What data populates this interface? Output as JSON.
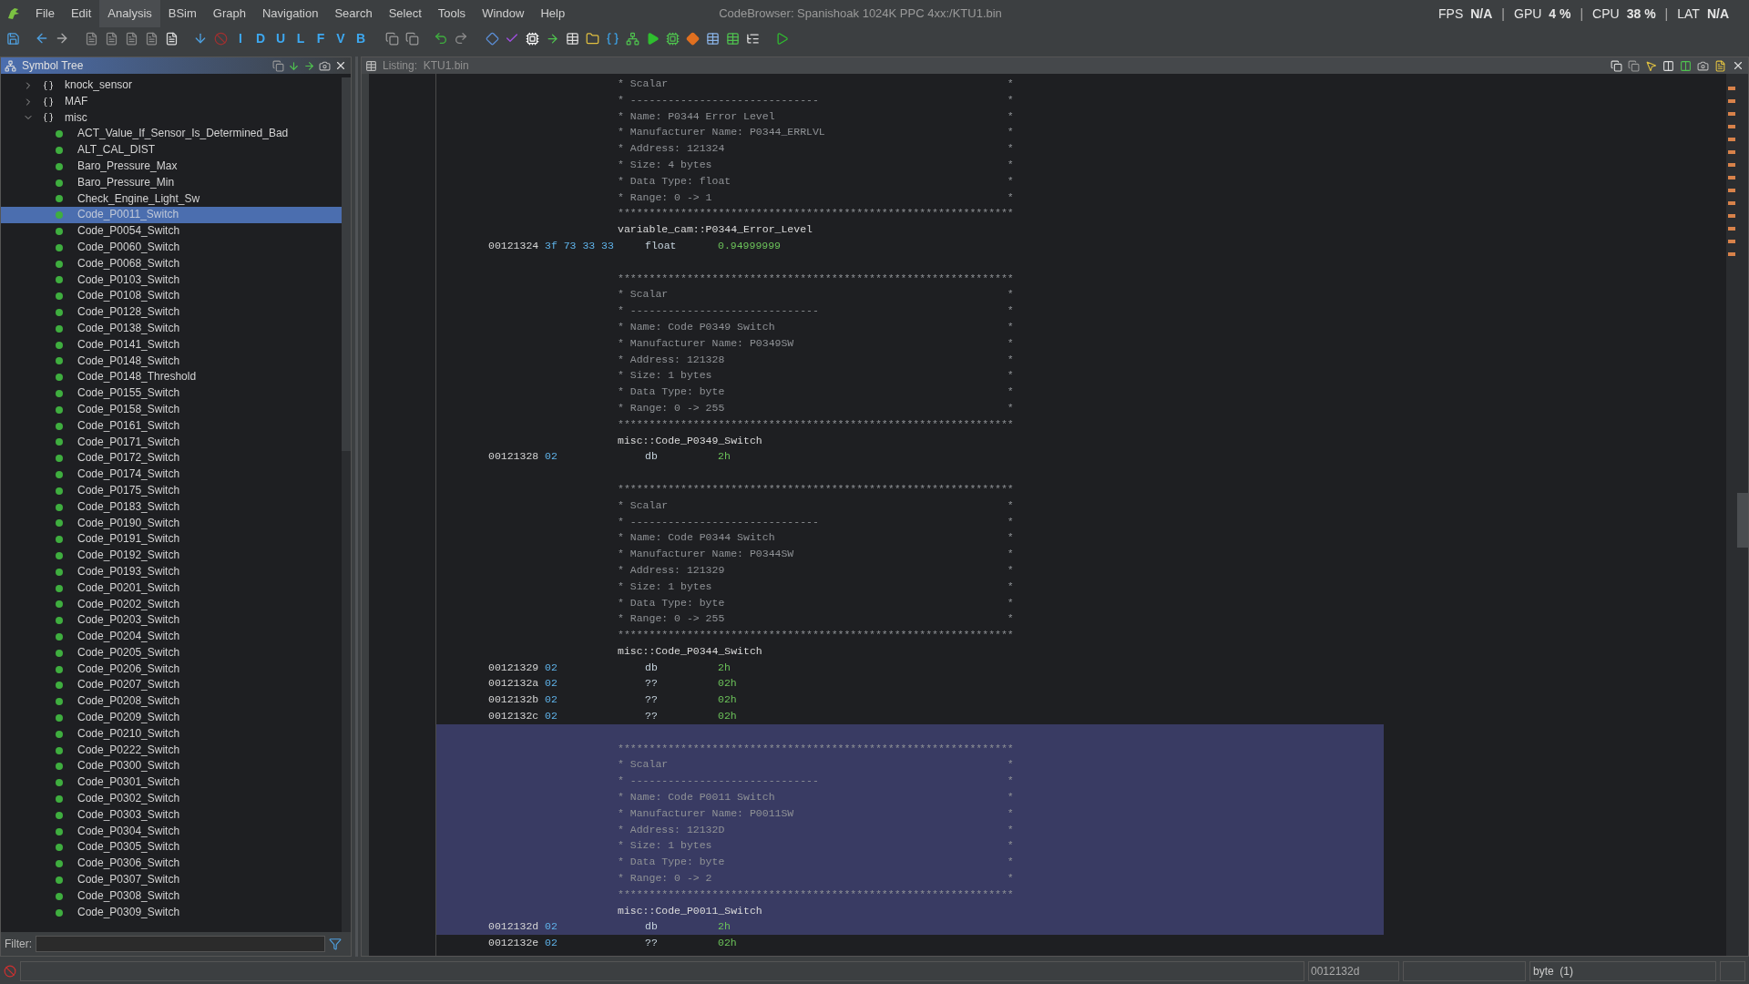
{
  "window": {
    "title": "CodeBrowser: Spanishoak 1024K PPC 4xx:/KTU1.bin"
  },
  "menu": [
    {
      "label": "File",
      "selected": false
    },
    {
      "label": "Edit",
      "selected": false
    },
    {
      "label": "Analysis",
      "selected": true
    },
    {
      "label": "BSim",
      "selected": false
    },
    {
      "label": "Graph",
      "selected": false
    },
    {
      "label": "Navigation",
      "selected": false
    },
    {
      "label": "Search",
      "selected": false
    },
    {
      "label": "Select",
      "selected": false
    },
    {
      "label": "Tools",
      "selected": false
    },
    {
      "label": "Window",
      "selected": false
    },
    {
      "label": "Help",
      "selected": false
    }
  ],
  "stats": [
    {
      "kind": "stat",
      "label": "FPS",
      "value": "N/A"
    },
    {
      "kind": "separator",
      "text": "|"
    },
    {
      "kind": "stat",
      "label": "GPU",
      "value": "4 %"
    },
    {
      "kind": "separator",
      "text": "|"
    },
    {
      "kind": "stat",
      "label": "CPU",
      "value": "38 %"
    },
    {
      "kind": "separator",
      "text": "|"
    },
    {
      "kind": "stat",
      "label": "LAT",
      "value": "N/A"
    }
  ],
  "toolbar": {
    "letter_buttons": [
      "I",
      "D",
      "U",
      "L",
      "F",
      "V",
      "B"
    ]
  },
  "symbol_tree": {
    "title": "Symbol Tree",
    "items": [
      {
        "label": "knock_sensor",
        "expanded": false
      },
      {
        "label": "MAF",
        "expanded": false
      },
      {
        "label": "misc",
        "expanded": true,
        "children": [
          {
            "label": "ACT_Value_If_Sensor_Is_Determined_Bad",
            "selected": false
          },
          {
            "label": "ALT_CAL_DIST",
            "selected": false
          },
          {
            "label": "Baro_Pressure_Max",
            "selected": false
          },
          {
            "label": "Baro_Pressure_Min",
            "selected": false
          },
          {
            "label": "Check_Engine_Light_Sw",
            "selected": false
          },
          {
            "label": "Code_P0011_Switch",
            "selected": true
          },
          {
            "label": "Code_P0054_Switch",
            "selected": false
          },
          {
            "label": "Code_P0060_Switch",
            "selected": false
          },
          {
            "label": "Code_P0068_Switch",
            "selected": false
          },
          {
            "label": "Code_P0103_Switch",
            "selected": false
          },
          {
            "label": "Code_P0108_Switch",
            "selected": false
          },
          {
            "label": "Code_P0128_Switch",
            "selected": false
          },
          {
            "label": "Code_P0138_Switch",
            "selected": false
          },
          {
            "label": "Code_P0141_Switch",
            "selected": false
          },
          {
            "label": "Code_P0148_Switch",
            "selected": false
          },
          {
            "label": "Code_P0148_Threshold",
            "selected": false
          },
          {
            "label": "Code_P0155_Switch",
            "selected": false
          },
          {
            "label": "Code_P0158_Switch",
            "selected": false
          },
          {
            "label": "Code_P0161_Switch",
            "selected": false
          },
          {
            "label": "Code_P0171_Switch",
            "selected": false
          },
          {
            "label": "Code_P0172_Switch",
            "selected": false
          },
          {
            "label": "Code_P0174_Switch",
            "selected": false
          },
          {
            "label": "Code_P0175_Switch",
            "selected": false
          },
          {
            "label": "Code_P0183_Switch",
            "selected": false
          },
          {
            "label": "Code_P0190_Switch",
            "selected": false
          },
          {
            "label": "Code_P0191_Switch",
            "selected": false
          },
          {
            "label": "Code_P0192_Switch",
            "selected": false
          },
          {
            "label": "Code_P0193_Switch",
            "selected": false
          },
          {
            "label": "Code_P0201_Switch",
            "selected": false
          },
          {
            "label": "Code_P0202_Switch",
            "selected": false
          },
          {
            "label": "Code_P0203_Switch",
            "selected": false
          },
          {
            "label": "Code_P0204_Switch",
            "selected": false
          },
          {
            "label": "Code_P0205_Switch",
            "selected": false
          },
          {
            "label": "Code_P0206_Switch",
            "selected": false
          },
          {
            "label": "Code_P0207_Switch",
            "selected": false
          },
          {
            "label": "Code_P0208_Switch",
            "selected": false
          },
          {
            "label": "Code_P0209_Switch",
            "selected": false
          },
          {
            "label": "Code_P0210_Switch",
            "selected": false
          },
          {
            "label": "Code_P0222_Switch",
            "selected": false
          },
          {
            "label": "Code_P0300_Switch",
            "selected": false
          },
          {
            "label": "Code_P0301_Switch",
            "selected": false
          },
          {
            "label": "Code_P0302_Switch",
            "selected": false
          },
          {
            "label": "Code_P0303_Switch",
            "selected": false
          },
          {
            "label": "Code_P0304_Switch",
            "selected": false
          },
          {
            "label": "Code_P0305_Switch",
            "selected": false
          },
          {
            "label": "Code_P0306_Switch",
            "selected": false
          },
          {
            "label": "Code_P0307_Switch",
            "selected": false
          },
          {
            "label": "Code_P0308_Switch",
            "selected": false
          },
          {
            "label": "Code_P0309_Switch",
            "selected": false
          }
        ]
      }
    ],
    "filter_label": "Filter:"
  },
  "listing": {
    "title": "Listing:  KTU1.bin",
    "blocks": [
      {
        "selected": false,
        "comment": [
          "* Scalar                                                      *",
          "* ------------------------------                              *",
          "* Name: P0344 Error Level                                     *",
          "* Manufacturer Name: P0344_ERRLVL                             *",
          "* Address: 121324                                             *",
          "* Size: 4 bytes                                               *",
          "* Data Type: float                                            *",
          "* Range: 0 -> 1                                               *",
          "***************************************************************"
        ],
        "label": "variable_cam::P0344_Error_Level",
        "rows": [
          {
            "address": "00121324",
            "bytes": "3f 73 33 33",
            "mnemonic": "float",
            "operand": "0.94999999"
          }
        ]
      },
      {
        "selected": false,
        "comment": [
          "***************************************************************",
          "* Scalar                                                      *",
          "* ------------------------------                              *",
          "* Name: Code P0349 Switch                                     *",
          "* Manufacturer Name: P0349SW                                  *",
          "* Address: 121328                                             *",
          "* Size: 1 bytes                                               *",
          "* Data Type: byte                                             *",
          "* Range: 0 -> 255                                             *",
          "***************************************************************"
        ],
        "label": "misc::Code_P0349_Switch",
        "rows": [
          {
            "address": "00121328",
            "bytes": "02",
            "mnemonic": "db",
            "operand": "2h"
          }
        ]
      },
      {
        "selected": false,
        "comment": [
          "***************************************************************",
          "* Scalar                                                      *",
          "* ------------------------------                              *",
          "* Name: Code P0344 Switch                                     *",
          "* Manufacturer Name: P0344SW                                  *",
          "* Address: 121329                                             *",
          "* Size: 1 bytes                                               *",
          "* Data Type: byte                                             *",
          "* Range: 0 -> 255                                             *",
          "***************************************************************"
        ],
        "label": "misc::Code_P0344_Switch",
        "rows": [
          {
            "address": "00121329",
            "bytes": "02",
            "mnemonic": "db",
            "operand": "2h"
          },
          {
            "address": "0012132a",
            "bytes": "02",
            "mnemonic": "??",
            "operand": "02h"
          },
          {
            "address": "0012132b",
            "bytes": "02",
            "mnemonic": "??",
            "operand": "02h"
          },
          {
            "address": "0012132c",
            "bytes": "02",
            "mnemonic": "??",
            "operand": "02h"
          }
        ]
      },
      {
        "selected": true,
        "comment": [
          "***************************************************************",
          "* Scalar                                                      *",
          "* ------------------------------                              *",
          "* Name: Code P0011 Switch                                     *",
          "* Manufacturer Name: P0011SW                                  *",
          "* Address: 12132D                                             *",
          "* Size: 1 bytes                                               *",
          "* Data Type: byte                                             *",
          "* Range: 0 -> 2                                               *",
          "***************************************************************"
        ],
        "label": "misc::Code_P0011_Switch",
        "rows": [
          {
            "address": "0012132d",
            "bytes": "02",
            "mnemonic": "db",
            "operand": "2h"
          }
        ]
      },
      {
        "selected": false,
        "rows": [
          {
            "address": "0012132e",
            "bytes": "02",
            "mnemonic": "??",
            "operand": "02h"
          }
        ]
      }
    ]
  },
  "status_bar": {
    "address": "0012132d",
    "data_type": "byte  (1)"
  }
}
